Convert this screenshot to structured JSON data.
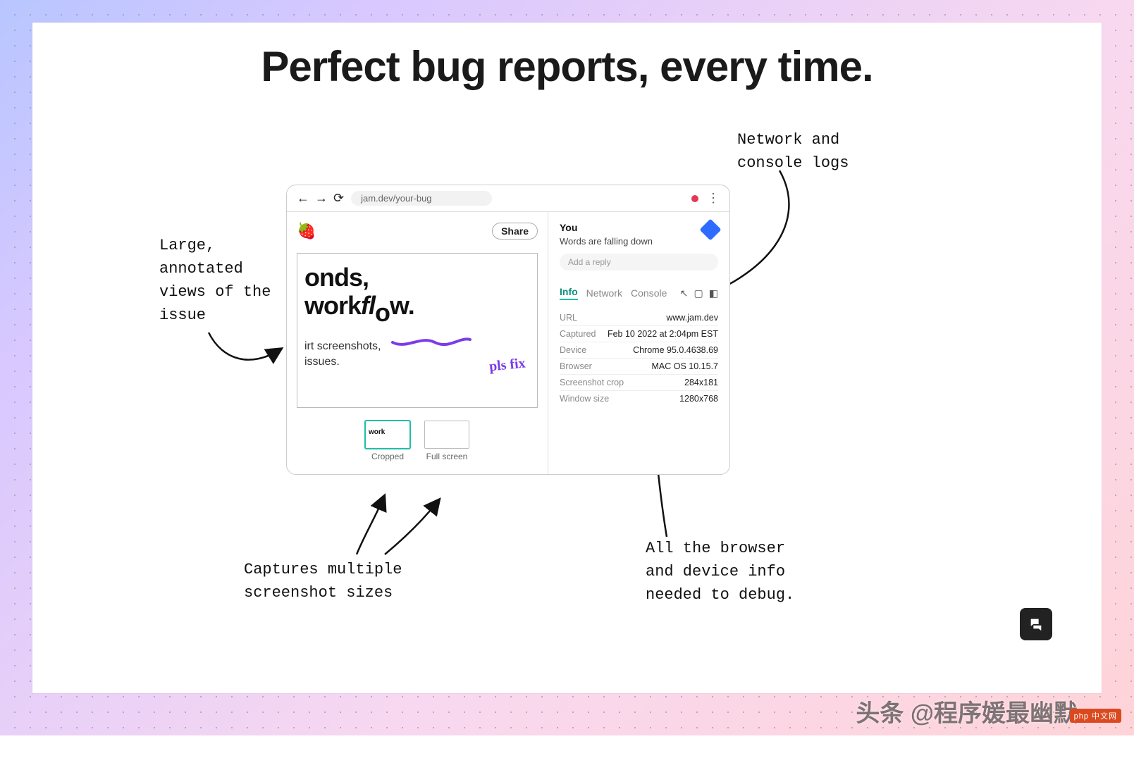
{
  "headline": "Perfect bug reports,\nevery time.",
  "annotations": {
    "left": "Large,\nannotated\nviews of the\nissue",
    "right": "Network and\nconsole logs",
    "bottom_left": "Captures multiple\nscreenshot sizes",
    "bottom_right": "All the browser\nand device info\nneeded to debug."
  },
  "browser": {
    "url": "jam.dev/your-bug",
    "share_label": "Share",
    "logo_icon": "strawberry-icon",
    "screenshot": {
      "line1_a": "onds,",
      "line2_prefix": "work",
      "line2_fl": "fl",
      "line2_o": "o",
      "line2_w": "w.",
      "small1": "irt screenshots,",
      "small2": "issues.",
      "note": "pls fix"
    },
    "thumbs": {
      "cropped": "Cropped",
      "fullscreen": "Full screen"
    },
    "right": {
      "you": "You",
      "message": "Words are falling down",
      "reply_placeholder": "Add a reply",
      "tabs": {
        "info": "Info",
        "network": "Network",
        "console": "Console"
      },
      "info": [
        {
          "k": "URL",
          "v": "www.jam.dev"
        },
        {
          "k": "Captured",
          "v": "Feb 10 2022 at 2:04pm EST"
        },
        {
          "k": "Device",
          "v": "Chrome 95.0.4638.69"
        },
        {
          "k": "Browser",
          "v": "MAC OS 10.15.7"
        },
        {
          "k": "Screenshot crop",
          "v": "284x181"
        },
        {
          "k": "Window size",
          "v": "1280x768"
        }
      ]
    }
  },
  "watermark": "头条 @程序媛最幽默",
  "watermark_badge": "php 中文网"
}
